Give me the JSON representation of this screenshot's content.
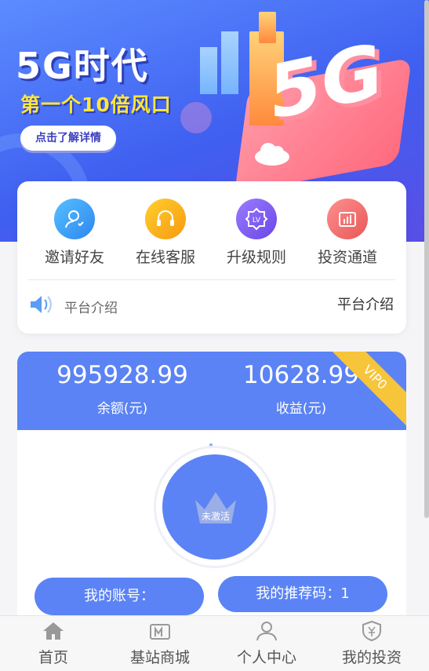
{
  "banner": {
    "title": "5G时代",
    "subtitle": "第一个10倍风口",
    "button_label": "点击了解详情",
    "art_text": "5G"
  },
  "menu": {
    "items": [
      {
        "label": "邀请好友",
        "icon": "invite-user-icon",
        "color": "#3aa0f5"
      },
      {
        "label": "在线客服",
        "icon": "headset-icon",
        "color": "#f7a91b"
      },
      {
        "label": "升级规则",
        "icon": "level-badge-icon",
        "color": "#7a5cf0"
      },
      {
        "label": "投资通道",
        "icon": "chart-icon",
        "color": "#f06a6a"
      }
    ],
    "notice_left": "平台介绍",
    "notice_right": "平台介绍"
  },
  "account": {
    "balance": "995928.99",
    "balance_label": "余额(元)",
    "income": "10628.99",
    "income_label": "收益(元)",
    "vip": "VIP0",
    "status": "未激活",
    "account_label": "我的账号：",
    "referral_label": "我的推荐码：1"
  },
  "tabbar": {
    "items": [
      {
        "label": "首页",
        "icon": "home-icon"
      },
      {
        "label": "基站商城",
        "icon": "store-icon"
      },
      {
        "label": "个人中心",
        "icon": "user-icon"
      },
      {
        "label": "我的投资",
        "icon": "yen-shield-icon"
      }
    ]
  },
  "colors": {
    "primary": "#5b83f5",
    "vip": "#f7c53a",
    "banner": "#4a6cf2"
  }
}
